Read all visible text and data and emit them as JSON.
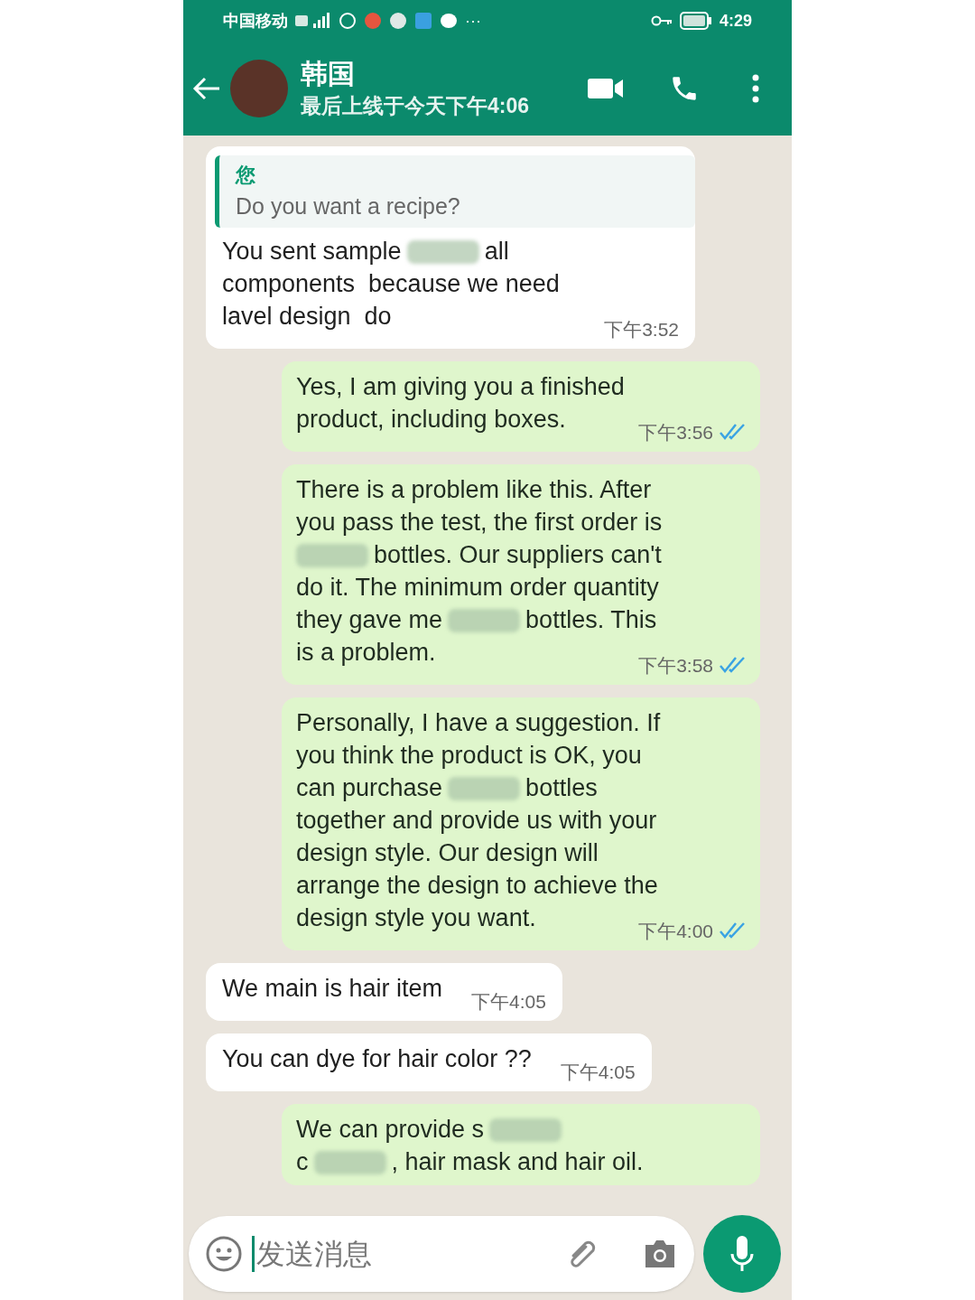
{
  "status_bar": {
    "carrier": "中国移动",
    "more": "···",
    "time": "4:29"
  },
  "header": {
    "name": "韩国",
    "last_seen": "最后上线于今天下午4:06"
  },
  "messages": [
    {
      "outgoing": false,
      "quote": {
        "author": "您",
        "text": "Do you want a recipe?"
      },
      "lines": [
        [
          {
            "kind": "text",
            "text": "You sent sample"
          },
          {
            "kind": "blur"
          },
          {
            "kind": "text",
            "text": "all"
          }
        ],
        [
          {
            "kind": "text",
            "text": "components  because we need"
          }
        ],
        [
          {
            "kind": "text",
            "text": "lavel design  do"
          }
        ]
      ],
      "time": "下午3:52"
    },
    {
      "outgoing": true,
      "lines": [
        [
          {
            "kind": "text",
            "text": "Yes, I am giving you a finished"
          }
        ],
        [
          {
            "kind": "text",
            "text": "product, including boxes."
          }
        ]
      ],
      "time": "下午3:56",
      "read": true
    },
    {
      "outgoing": true,
      "lines": [
        [
          {
            "kind": "text",
            "text": "There is a problem like this. After"
          }
        ],
        [
          {
            "kind": "text",
            "text": "you pass the test, the first order is"
          }
        ],
        [
          {
            "kind": "blur"
          },
          {
            "kind": "text",
            "text": "bottles. Our suppliers can't"
          }
        ],
        [
          {
            "kind": "text",
            "text": "do it. The minimum order quantity"
          }
        ],
        [
          {
            "kind": "text",
            "text": "they gave me"
          },
          {
            "kind": "blur"
          },
          {
            "kind": "text",
            "text": "bottles. This"
          }
        ],
        [
          {
            "kind": "text",
            "text": "is a problem."
          }
        ]
      ],
      "time": "下午3:58",
      "read": true
    },
    {
      "outgoing": true,
      "lines": [
        [
          {
            "kind": "text",
            "text": "Personally, I have a suggestion. If"
          }
        ],
        [
          {
            "kind": "text",
            "text": "you think the product is OK, you"
          }
        ],
        [
          {
            "kind": "text",
            "text": "can purchase"
          },
          {
            "kind": "blur"
          },
          {
            "kind": "text",
            "text": "bottles"
          }
        ],
        [
          {
            "kind": "text",
            "text": "together and provide us with your"
          }
        ],
        [
          {
            "kind": "text",
            "text": "design style. Our design will"
          }
        ],
        [
          {
            "kind": "text",
            "text": "arrange the design to achieve the"
          }
        ],
        [
          {
            "kind": "text",
            "text": "design style you want."
          }
        ]
      ],
      "time": "下午4:00",
      "read": true
    },
    {
      "outgoing": false,
      "lines": [
        [
          {
            "kind": "text",
            "text": "We main is hair item"
          }
        ]
      ],
      "time": "下午4:05"
    },
    {
      "outgoing": false,
      "lines": [
        [
          {
            "kind": "text",
            "text": "You can dye for hair color ??"
          }
        ]
      ],
      "time": "下午4:05"
    },
    {
      "outgoing": true,
      "lines": [
        [
          {
            "kind": "text",
            "text": "We can provide s"
          },
          {
            "kind": "blur"
          }
        ],
        [
          {
            "kind": "text",
            "text": "c"
          },
          {
            "kind": "blur"
          },
          {
            "kind": "text",
            "text": ", hair mask and hair oil."
          }
        ]
      ]
    }
  ],
  "composer": {
    "placeholder": "发送消息"
  }
}
